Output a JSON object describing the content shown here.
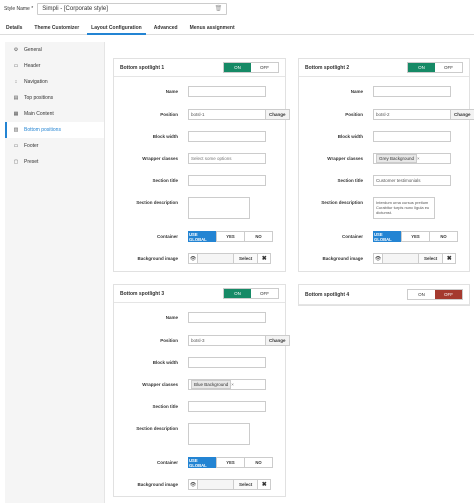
{
  "style_name": {
    "label": "Style Name *",
    "value": "Simpli - [Corporate style]",
    "clear_icon": "trash-icon"
  },
  "tabs": [
    "Details",
    "Theme Customizer",
    "Layout Configuration",
    "Advanced",
    "Menus assignment"
  ],
  "active_tab": "Layout Configuration",
  "sidebar": [
    {
      "label": "General",
      "icon": "gear-icon",
      "glyph": "⚙"
    },
    {
      "label": "Header",
      "icon": "header-icon",
      "glyph": "▭"
    },
    {
      "label": "Navigation",
      "icon": "navigation-icon",
      "glyph": "↕"
    },
    {
      "label": "Top positions",
      "icon": "top-positions-icon",
      "glyph": "▤"
    },
    {
      "label": "Main Content",
      "icon": "main-content-icon",
      "glyph": "▦"
    },
    {
      "label": "Bottom positions",
      "icon": "bottom-positions-icon",
      "glyph": "▥"
    },
    {
      "label": "Footer",
      "icon": "footer-icon",
      "glyph": "▭"
    },
    {
      "label": "Preset",
      "icon": "preset-icon",
      "glyph": "▢"
    }
  ],
  "active_sidebar": "Bottom positions",
  "labels": {
    "name": "Name",
    "position": "Position",
    "block_width": "Block width",
    "wrapper_classes": "Wrapper classes",
    "section_title": "Section title",
    "section_description": "Section description",
    "container": "Container",
    "background_image": "Background image"
  },
  "buttons": {
    "on": "ON",
    "off": "OFF",
    "change": "Change",
    "use_global": "USE GLOBAL",
    "yes": "YES",
    "no": "NO",
    "select": "Select"
  },
  "wrapper_placeholder": "Select some options",
  "spotlight1": {
    "title": "Bottom spotlight 1",
    "state": "on",
    "position": "botsl-1",
    "wrapper": "",
    "section_title": "",
    "description": ""
  },
  "spotlight2": {
    "title": "Bottom spotlight 2",
    "state": "on",
    "position": "botsl-2",
    "wrapper": "Grey Background",
    "section_title": "Customer testimonials",
    "description": "Interdum urna cursus pretium Curabitur turpis nunc ligula eu dictumst."
  },
  "spotlight3": {
    "title": "Bottom spotlight 3",
    "state": "on",
    "position": "botsl-3",
    "wrapper": "Blue Background",
    "section_title": "",
    "description": ""
  },
  "spotlight4": {
    "title": "Bottom spotlight 4",
    "state": "off"
  },
  "colors": {
    "on": "#168a66",
    "off": "#a53a2f",
    "accent": "#2384d3"
  }
}
